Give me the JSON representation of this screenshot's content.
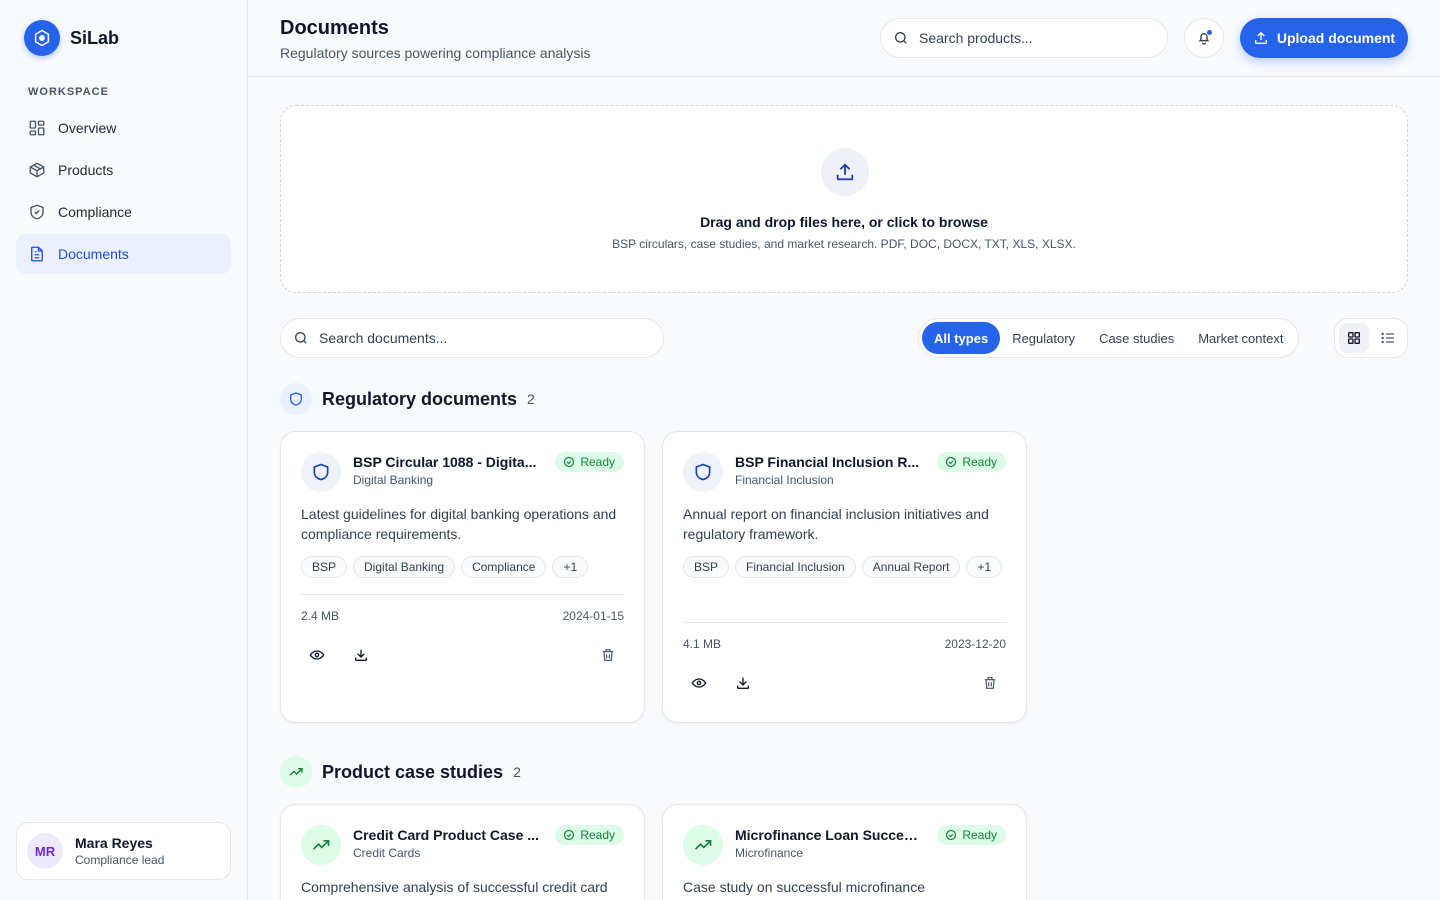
{
  "brand": {
    "name": "SiLab"
  },
  "sidebar": {
    "section_label": "WORKSPACE",
    "items": [
      {
        "label": "Overview",
        "icon": "grid-icon"
      },
      {
        "label": "Products",
        "icon": "box-icon"
      },
      {
        "label": "Compliance",
        "icon": "shield-check-icon"
      },
      {
        "label": "Documents",
        "icon": "file-text-icon",
        "active": true
      }
    ],
    "user": {
      "initials": "MR",
      "name": "Mara Reyes",
      "role": "Compliance lead"
    }
  },
  "header": {
    "title": "Documents",
    "subtitle": "Regulatory sources powering compliance analysis",
    "search_placeholder": "Search products...",
    "upload_label": "Upload document"
  },
  "dropzone": {
    "title": "Drag and drop files here, or click to browse",
    "subtitle": "BSP circulars, case studies, and market research. PDF, DOC, DOCX, TXT, XLS, XLSX."
  },
  "toolbar": {
    "search_placeholder": "Search documents...",
    "filters": [
      "All types",
      "Regulatory",
      "Case studies",
      "Market context"
    ],
    "active_filter": "All types"
  },
  "sections": [
    {
      "title": "Regulatory documents",
      "count": "2",
      "cards": [
        {
          "title": "BSP Circular 1088 - Digita...",
          "category": "Digital Banking",
          "status": "Ready",
          "description": "Latest guidelines for digital banking operations and compliance requirements.",
          "tags": [
            "BSP",
            "Digital Banking",
            "Compliance",
            "+1"
          ],
          "size": "2.4 MB",
          "date": "2024-01-15"
        },
        {
          "title": "BSP Financial Inclusion R...",
          "category": "Financial Inclusion",
          "status": "Ready",
          "description": "Annual report on financial inclusion initiatives and regulatory framework.",
          "tags": [
            "BSP",
            "Financial Inclusion",
            "Annual Report",
            "+1"
          ],
          "size": "4.1 MB",
          "date": "2023-12-20"
        }
      ]
    },
    {
      "title": "Product case studies",
      "count": "2",
      "cards": [
        {
          "title": "Credit Card Product Case ...",
          "category": "Credit Cards",
          "status": "Ready",
          "description": "Comprehensive analysis of successful credit card"
        },
        {
          "title": "Microfinance Loan Succes...",
          "category": "Microfinance",
          "status": "Ready",
          "description": "Case study on successful microfinance"
        }
      ]
    }
  ],
  "colors": {
    "accent": "#2563eb",
    "ready_bg": "#dcfce7",
    "ready_fg": "#15803d"
  }
}
